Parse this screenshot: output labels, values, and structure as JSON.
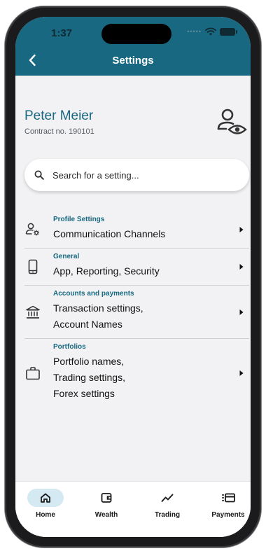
{
  "status_bar": {
    "time": "1:37"
  },
  "nav": {
    "title": "Settings"
  },
  "user": {
    "name": "Peter Meier",
    "contract": "Contract no. 190101"
  },
  "search": {
    "placeholder": "Search for a setting..."
  },
  "settings": [
    {
      "category": "Profile Settings",
      "lines": [
        "Communication Channels"
      ]
    },
    {
      "category": "General",
      "lines": [
        "App, Reporting, Security"
      ]
    },
    {
      "category": "Accounts and payments",
      "lines": [
        "Transaction settings,",
        "Account Names"
      ]
    },
    {
      "category": "Portfolios",
      "lines": [
        "Portfolio names,",
        "Trading settings,",
        "Forex settings"
      ]
    }
  ],
  "bottom_nav": [
    {
      "label": "Home",
      "icon": "home-icon",
      "active": true
    },
    {
      "label": "Wealth",
      "icon": "wallet-icon",
      "active": false
    },
    {
      "label": "Trading",
      "icon": "trend-icon",
      "active": false
    },
    {
      "label": "Payments",
      "icon": "card-icon",
      "active": false
    }
  ],
  "colors": {
    "brand": "#176880",
    "background": "#f2f2f4",
    "active_nav": "#d5e9f3"
  }
}
